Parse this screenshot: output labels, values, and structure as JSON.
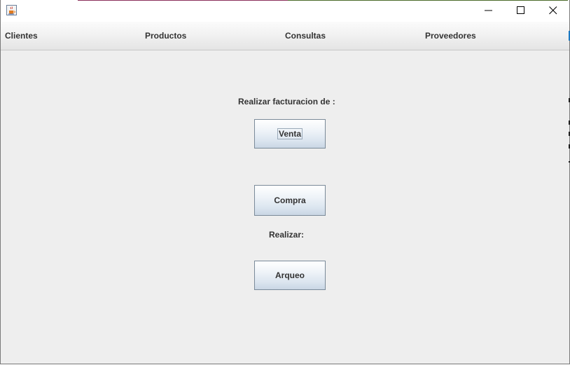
{
  "window": {
    "icon": "java-cup-icon",
    "controls": {
      "minimize": "minimize-icon",
      "maximize": "maximize-icon",
      "close": "close-icon"
    }
  },
  "menubar": {
    "items": [
      {
        "label": "Clientes"
      },
      {
        "label": "Productos"
      },
      {
        "label": "Consultas"
      },
      {
        "label": "Proveedores"
      }
    ]
  },
  "main": {
    "facturacion_label": "Realizar facturacion de :",
    "venta_button": "Venta",
    "compra_button": "Compra",
    "realizar_label": "Realizar:",
    "arqueo_button": "Arqueo"
  },
  "colors": {
    "background": "#eeeeee",
    "button_gradient_top": "#ffffff",
    "button_gradient_bottom": "#c9d6e4",
    "button_border": "#7a8a99"
  }
}
